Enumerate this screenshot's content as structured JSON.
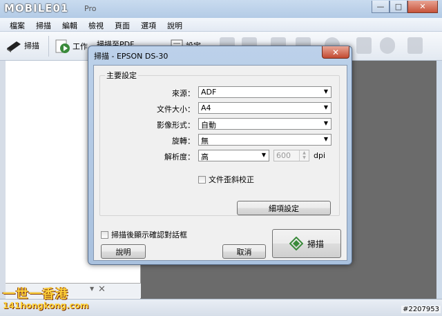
{
  "app": {
    "logo_text": "MOBILE01",
    "title_suffix": "Pro",
    "window_buttons": {
      "minimize": "—",
      "maximize": "□",
      "close": "✕"
    }
  },
  "menu": [
    "檔案",
    "掃描",
    "編輯",
    "檢視",
    "頁面",
    "選項",
    "說明"
  ],
  "toolbar": {
    "scan_label": "掃描",
    "work_label": "工作",
    "pdf_label": "掃描至PDF",
    "settings_label": "設定"
  },
  "dialog": {
    "title": "掃描 - EPSON DS-30",
    "close": "✕",
    "group_title": "主要設定",
    "fields": [
      {
        "label": "來源：",
        "value": "ADF"
      },
      {
        "label": "文件大小：",
        "value": "A4"
      },
      {
        "label": "影像形式：",
        "value": "自動"
      },
      {
        "label": "旋轉：",
        "value": "無"
      }
    ],
    "resolution": {
      "label": "解析度：",
      "value": "高",
      "dpi_value": "600",
      "unit": "dpi"
    },
    "deskew_label": "文件歪斜校正",
    "detail_button": "細項設定",
    "confirm_label": "掃描後顯示確認對話框",
    "help_button": "說明",
    "cancel_button": "取消",
    "scan_button": "掃描"
  },
  "watermark": {
    "line1": "一世一香港",
    "line2": "141hongkong.com",
    "id": "#2207953"
  },
  "colors": {
    "accent": "#3a8a3a",
    "close_red": "#c7533a"
  }
}
